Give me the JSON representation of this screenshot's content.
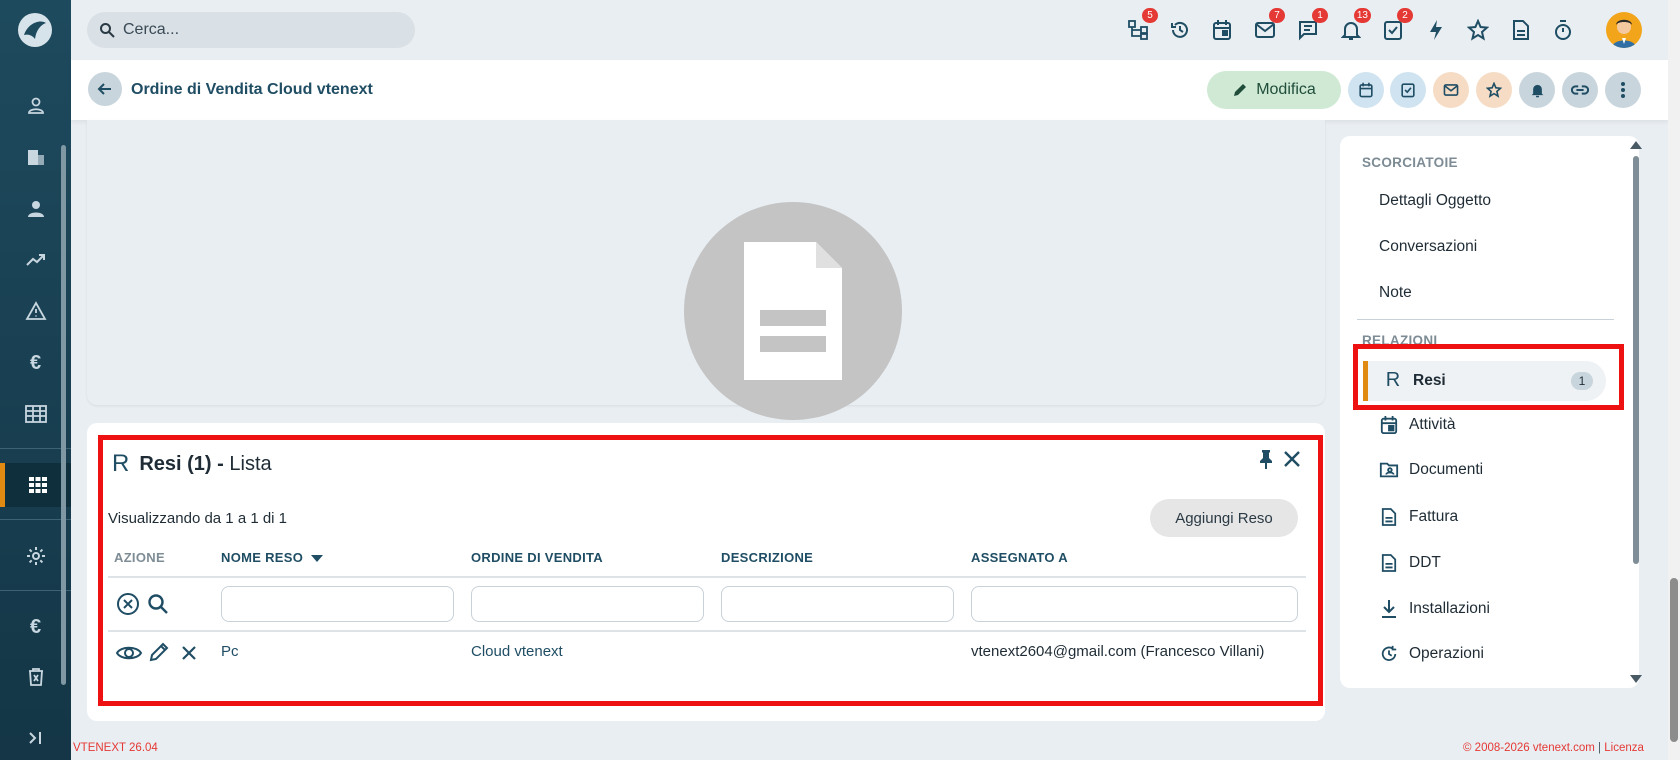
{
  "search": {
    "placeholder": "Cerca..."
  },
  "topbar": {
    "icons": [
      {
        "name": "hierarchy-icon",
        "badge": "5"
      },
      {
        "name": "history-icon",
        "badge": ""
      },
      {
        "name": "calendar-icon",
        "badge": ""
      },
      {
        "name": "mail-icon",
        "badge": "7"
      },
      {
        "name": "chat-icon",
        "badge": "1"
      },
      {
        "name": "bell-icon",
        "badge": "13"
      },
      {
        "name": "task-check-icon",
        "badge": "2"
      },
      {
        "name": "lightning-icon",
        "badge": ""
      },
      {
        "name": "star-icon",
        "badge": ""
      },
      {
        "name": "document-icon",
        "badge": ""
      },
      {
        "name": "stopwatch-icon",
        "badge": ""
      }
    ]
  },
  "header": {
    "title": "Ordine di Vendita Cloud vtenext",
    "edit_label": "Modifica"
  },
  "list": {
    "title_bold": "Resi (1) -",
    "title_rest": "Lista",
    "count_info": "Visualizzando da 1 a 1 di 1",
    "add_label": "Aggiungi Reso",
    "columns": {
      "azione": "AZIONE",
      "nome": "NOME RESO",
      "ordine": "ORDINE DI VENDITA",
      "descrizione": "DESCRIZIONE",
      "assegnato": "ASSEGNATO A"
    },
    "rows": [
      {
        "nome": "Pc",
        "ordine": "Cloud vtenext",
        "descrizione": "",
        "assegnato": "vtenext2604@gmail.com (Francesco Villani)"
      }
    ]
  },
  "shortcuts": {
    "label": "SCORCIATOIE",
    "items": [
      "Dettagli Oggetto",
      "Conversazioni",
      "Note"
    ]
  },
  "relations": {
    "label": "RELAZIONI",
    "resi": {
      "letter": "R",
      "label": "Resi",
      "count": "1"
    },
    "items": [
      {
        "label": "Attività",
        "icon": "calendar-icon"
      },
      {
        "label": "Documenti",
        "icon": "folder-icon"
      },
      {
        "label": "Fattura",
        "icon": "invoice-icon"
      },
      {
        "label": "DDT",
        "icon": "ddt-document-icon"
      },
      {
        "label": "Installazioni",
        "icon": "download-icon"
      },
      {
        "label": "Operazioni",
        "icon": "cycle-icon"
      }
    ]
  },
  "footer": {
    "version": "VTENEXT 26.04",
    "copyright": "© 2008-2026 vtenext.com",
    "sep": " | ",
    "license": "Licenza"
  },
  "colors": {
    "accent": "#e08a12",
    "primary": "#1f4d64",
    "highlight": "#ee1111",
    "badge": "#e53935"
  }
}
